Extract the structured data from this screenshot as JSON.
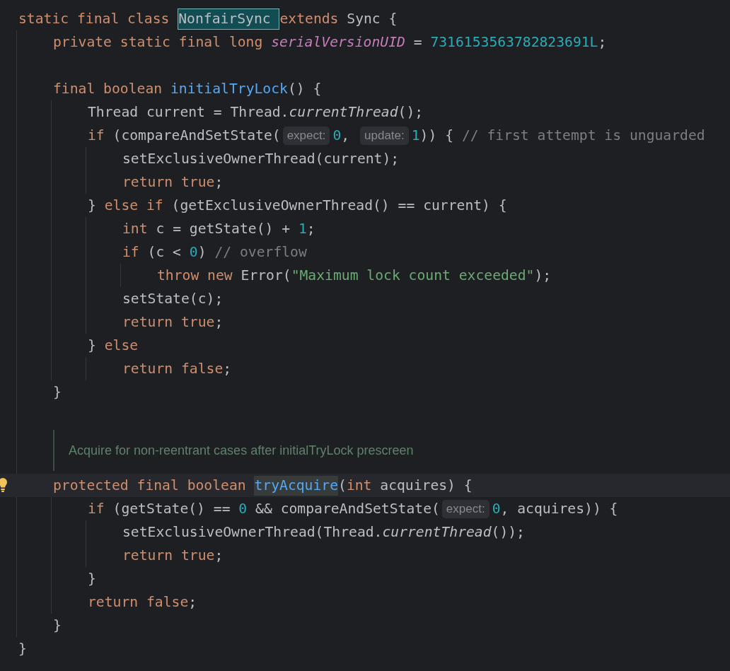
{
  "editor": {
    "lines": [
      {
        "kind": "code",
        "tokens": [
          {
            "kind": "keyword",
            "text": "static final class "
          },
          {
            "kind": "plain",
            "text": "NonfairSync ",
            "boxed": true
          },
          {
            "kind": "keyword",
            "text": "extends "
          },
          {
            "kind": "plain",
            "text": "Sync {"
          }
        ],
        "children": [
          {
            "kind": "code",
            "tokens": [
              {
                "kind": "keyword",
                "text": "private static final long "
              },
              {
                "kind": "field",
                "text": "serialVersionUID"
              },
              {
                "kind": "plain",
                "text": " = "
              },
              {
                "kind": "number",
                "text": "7316153563782823691L"
              },
              {
                "kind": "plain",
                "text": ";"
              }
            ]
          },
          {
            "kind": "blank"
          },
          {
            "kind": "code",
            "tokens": [
              {
                "kind": "keyword",
                "text": "final boolean "
              },
              {
                "kind": "method",
                "text": "initialTryLock"
              },
              {
                "kind": "plain",
                "text": "() {"
              }
            ],
            "children": [
              {
                "kind": "code",
                "tokens": [
                  {
                    "kind": "plain",
                    "text": "Thread current = Thread."
                  },
                  {
                    "kind": "static_call",
                    "text": "currentThread"
                  },
                  {
                    "kind": "plain",
                    "text": "();"
                  }
                ]
              },
              {
                "kind": "code",
                "tokens": [
                  {
                    "kind": "keyword",
                    "text": "if "
                  },
                  {
                    "kind": "plain",
                    "text": "(compareAndSetState("
                  },
                  {
                    "kind": "hint",
                    "text": "expect:"
                  },
                  {
                    "kind": "number",
                    "text": "0"
                  },
                  {
                    "kind": "plain",
                    "text": ", "
                  },
                  {
                    "kind": "hint",
                    "text": "update:"
                  },
                  {
                    "kind": "number",
                    "text": "1"
                  },
                  {
                    "kind": "plain",
                    "text": ")) { "
                  },
                  {
                    "kind": "comment",
                    "text": "// first attempt is unguarded"
                  }
                ],
                "children": [
                  {
                    "kind": "code",
                    "tokens": [
                      {
                        "kind": "plain",
                        "text": "setExclusiveOwnerThread(current);"
                      }
                    ]
                  },
                  {
                    "kind": "code",
                    "tokens": [
                      {
                        "kind": "keyword",
                        "text": "return true"
                      },
                      {
                        "kind": "plain",
                        "text": ";"
                      }
                    ]
                  }
                ]
              },
              {
                "kind": "code",
                "tokens": [
                  {
                    "kind": "plain",
                    "text": "} "
                  },
                  {
                    "kind": "keyword",
                    "text": "else if "
                  },
                  {
                    "kind": "plain",
                    "text": "(getExclusiveOwnerThread() == current) {"
                  }
                ],
                "children": [
                  {
                    "kind": "code",
                    "tokens": [
                      {
                        "kind": "keyword",
                        "text": "int "
                      },
                      {
                        "kind": "plain",
                        "text": "c = getState() + "
                      },
                      {
                        "kind": "number",
                        "text": "1"
                      },
                      {
                        "kind": "plain",
                        "text": ";"
                      }
                    ]
                  },
                  {
                    "kind": "code",
                    "tokens": [
                      {
                        "kind": "keyword",
                        "text": "if "
                      },
                      {
                        "kind": "plain",
                        "text": "(c < "
                      },
                      {
                        "kind": "number",
                        "text": "0"
                      },
                      {
                        "kind": "plain",
                        "text": ") "
                      },
                      {
                        "kind": "comment",
                        "text": "// overflow"
                      }
                    ],
                    "children": [
                      {
                        "kind": "code",
                        "tokens": [
                          {
                            "kind": "keyword",
                            "text": "throw new "
                          },
                          {
                            "kind": "plain",
                            "text": "Error("
                          },
                          {
                            "kind": "string",
                            "text": "\"Maximum lock count exceeded\""
                          },
                          {
                            "kind": "plain",
                            "text": ");"
                          }
                        ]
                      }
                    ]
                  },
                  {
                    "kind": "code",
                    "tokens": [
                      {
                        "kind": "plain",
                        "text": "setState(c);"
                      }
                    ]
                  },
                  {
                    "kind": "code",
                    "tokens": [
                      {
                        "kind": "keyword",
                        "text": "return true"
                      },
                      {
                        "kind": "plain",
                        "text": ";"
                      }
                    ]
                  }
                ]
              },
              {
                "kind": "code",
                "tokens": [
                  {
                    "kind": "plain",
                    "text": "} "
                  },
                  {
                    "kind": "keyword",
                    "text": "else"
                  }
                ],
                "children": [
                  {
                    "kind": "code",
                    "tokens": [
                      {
                        "kind": "keyword",
                        "text": "return false"
                      },
                      {
                        "kind": "plain",
                        "text": ";"
                      }
                    ]
                  }
                ]
              }
            ]
          },
          {
            "kind": "code",
            "tokens": [
              {
                "kind": "plain",
                "text": "}"
              }
            ]
          },
          {
            "kind": "blank"
          },
          {
            "kind": "doc",
            "text": "Acquire for non-reentrant cases after initialTryLock prescreen"
          },
          {
            "kind": "code",
            "current": true,
            "tokens": [
              {
                "kind": "keyword",
                "text": "protected final boolean "
              },
              {
                "kind": "method",
                "text": "tryAcquire",
                "highlighted": true
              },
              {
                "kind": "plain",
                "text": "("
              },
              {
                "kind": "keyword",
                "text": "int "
              },
              {
                "kind": "plain",
                "text": "acquires) {"
              }
            ],
            "children": [
              {
                "kind": "code",
                "tokens": [
                  {
                    "kind": "keyword",
                    "text": "if "
                  },
                  {
                    "kind": "plain",
                    "text": "(getState() == "
                  },
                  {
                    "kind": "number",
                    "text": "0"
                  },
                  {
                    "kind": "plain",
                    "text": " && compareAndSetState("
                  },
                  {
                    "kind": "hint",
                    "text": "expect:"
                  },
                  {
                    "kind": "number",
                    "text": "0"
                  },
                  {
                    "kind": "plain",
                    "text": ", acquires)) {"
                  }
                ],
                "children": [
                  {
                    "kind": "code",
                    "tokens": [
                      {
                        "kind": "plain",
                        "text": "setExclusiveOwnerThread(Thread."
                      },
                      {
                        "kind": "static_call",
                        "text": "currentThread"
                      },
                      {
                        "kind": "plain",
                        "text": "());"
                      }
                    ]
                  },
                  {
                    "kind": "code",
                    "tokens": [
                      {
                        "kind": "keyword",
                        "text": "return true"
                      },
                      {
                        "kind": "plain",
                        "text": ";"
                      }
                    ]
                  }
                ]
              },
              {
                "kind": "code",
                "tokens": [
                  {
                    "kind": "plain",
                    "text": "}"
                  }
                ]
              },
              {
                "kind": "code",
                "tokens": [
                  {
                    "kind": "keyword",
                    "text": "return false"
                  },
                  {
                    "kind": "plain",
                    "text": ";"
                  }
                ]
              }
            ]
          },
          {
            "kind": "code",
            "tokens": [
              {
                "kind": "plain",
                "text": "}"
              }
            ]
          }
        ]
      },
      {
        "kind": "code",
        "tokens": [
          {
            "kind": "plain",
            "text": "}"
          }
        ]
      }
    ]
  }
}
